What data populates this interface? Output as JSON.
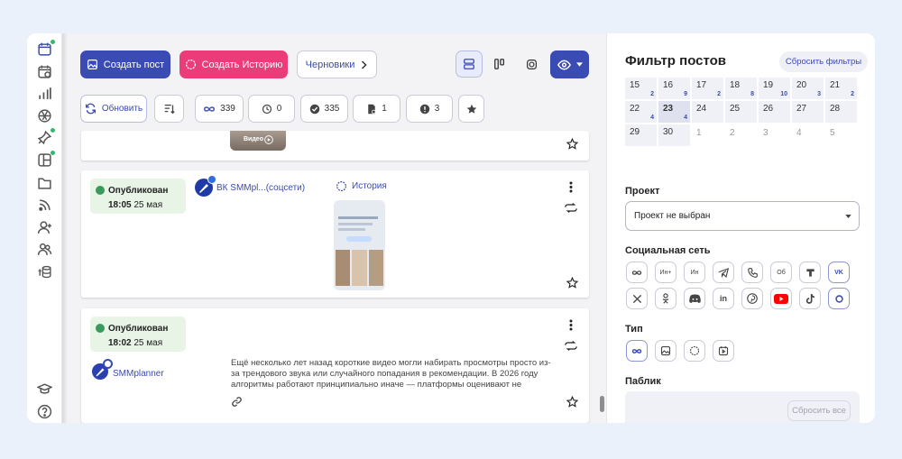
{
  "toolbar": {
    "create_post": "Создать пост",
    "create_story": "Создать Историю",
    "drafts": "Черновики"
  },
  "actions": {
    "refresh": "Обновить",
    "count_all": "339",
    "count_scheduled": "0",
    "count_published": "335",
    "count_drafts": "1",
    "count_errors": "3"
  },
  "post0": {
    "video_badge": "Видео"
  },
  "post1": {
    "status": "Опубликован",
    "time": "18:05",
    "date": " 25 мая",
    "account": "ВК SMMpl...(соцсети)",
    "type_label": "История"
  },
  "post2": {
    "status": "Опубликован",
    "time": "18:02",
    "date": " 25 мая",
    "account": "SMMplanner",
    "text": "Ещё несколько лет назад короткие видео могли набирать просмотры просто из-за трендового звука или случайного попадания в рекомендации. В 2026 году алгоритмы работают принципиально иначе — платформы оценивают не количество"
  },
  "filter": {
    "title": "Фильтр постов",
    "reset": "Сбросить фильтры",
    "project_label": "Проект",
    "project_value": "Проект не выбран",
    "social_label": "Социальная сеть",
    "type_label": "Тип",
    "public_label": "Паблик",
    "reset_all": "Сбросить все"
  },
  "calendar": {
    "row1": [
      {
        "d": "15",
        "c": "2"
      },
      {
        "d": "16",
        "c": "9"
      },
      {
        "d": "17",
        "c": "2"
      },
      {
        "d": "18",
        "c": "8"
      },
      {
        "d": "19",
        "c": "10"
      },
      {
        "d": "20",
        "c": "3"
      },
      {
        "d": "21",
        "c": "2"
      }
    ],
    "row2": [
      {
        "d": "22",
        "c": "4"
      },
      {
        "d": "23",
        "c": "4"
      },
      {
        "d": "24",
        "c": ""
      },
      {
        "d": "25",
        "c": ""
      },
      {
        "d": "26",
        "c": ""
      },
      {
        "d": "27",
        "c": ""
      },
      {
        "d": "28",
        "c": ""
      }
    ],
    "row3": [
      {
        "d": "29"
      },
      {
        "d": "30"
      },
      {
        "d": "1"
      },
      {
        "d": "2"
      },
      {
        "d": "3"
      },
      {
        "d": "4"
      },
      {
        "d": "5"
      }
    ]
  },
  "social_text": {
    "ig_plus": "Ин+",
    "ig": "Ин",
    "ok": "Об",
    "vk": "VK",
    "li": "in"
  },
  "colors": {
    "accent": "#3a4bb3",
    "pink": "#ec3b79",
    "published_bg": "#e7f4e6",
    "youtube": "#ff0000"
  }
}
